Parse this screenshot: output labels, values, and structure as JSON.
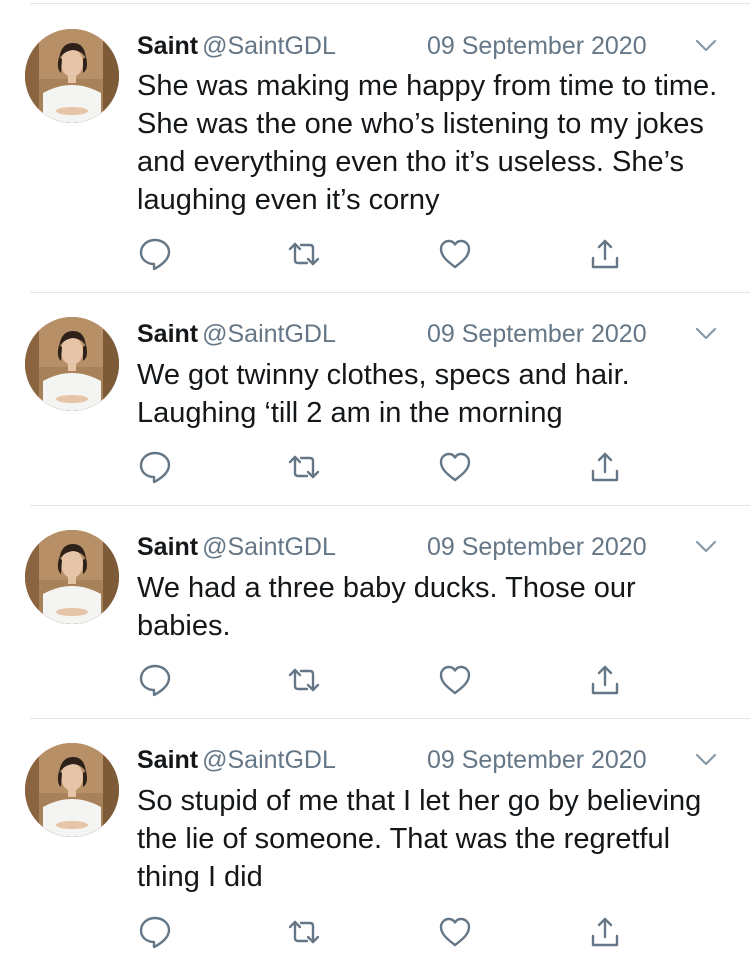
{
  "tweets": [
    {
      "name": "Saint",
      "handle": "@SaintGDL",
      "date": "09 September 2020",
      "text": "She was making me happy from time to time. She was the one who’s listening to my jokes and everything even tho it’s useless. She’s laughing even it’s corny"
    },
    {
      "name": "Saint",
      "handle": "@SaintGDL",
      "date": "09 September 2020",
      "text": "We got twinny clothes, specs and hair. Laughing ‘till 2 am in the morning"
    },
    {
      "name": "Saint",
      "handle": "@SaintGDL",
      "date": "09 September 2020",
      "text": "We had a three baby ducks. Those our babies."
    },
    {
      "name": "Saint",
      "handle": "@SaintGDL",
      "date": "09 September 2020",
      "text": "So stupid of me that I let her go by believing the lie of someone. That was the regretful thing I did"
    }
  ],
  "icons": {
    "reply": "reply-icon",
    "retweet": "retweet-icon",
    "like": "like-icon",
    "share": "share-icon",
    "more": "chevron-down-icon"
  },
  "colors": {
    "text": "#14171a",
    "secondary": "#657786",
    "divider": "#e1e8ed"
  }
}
